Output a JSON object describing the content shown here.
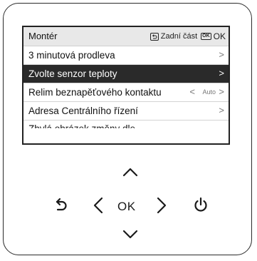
{
  "screen": {
    "title": "Montér",
    "hint_back": "Zadní část",
    "hint_ok_icon": "OK",
    "hint_ok": "OK"
  },
  "menu": {
    "items": [
      {
        "label": "3 minutová prodleva",
        "selected": false
      },
      {
        "label": "Zvolte senzor teploty",
        "selected": true
      },
      {
        "label": "Relim beznapěťového kontaktu",
        "value": "Auto",
        "selected": false
      },
      {
        "label": "Adresa Centrálního řízení",
        "selected": false
      },
      {
        "label": "Zbylá obrázek změny dle",
        "selected": false
      }
    ],
    "chevron": ">",
    "left_chevron": "<"
  },
  "buttons": {
    "ok_label": "OK",
    "icons": [
      "up-arrow-icon",
      "left-arrow-icon",
      "right-arrow-icon",
      "down-arrow-icon",
      "back-icon",
      "power-icon"
    ]
  },
  "colors": {
    "frame": "#2b2b2b",
    "header_bg": "#e8e8e8",
    "selected_bg": "#2a2a2a"
  }
}
